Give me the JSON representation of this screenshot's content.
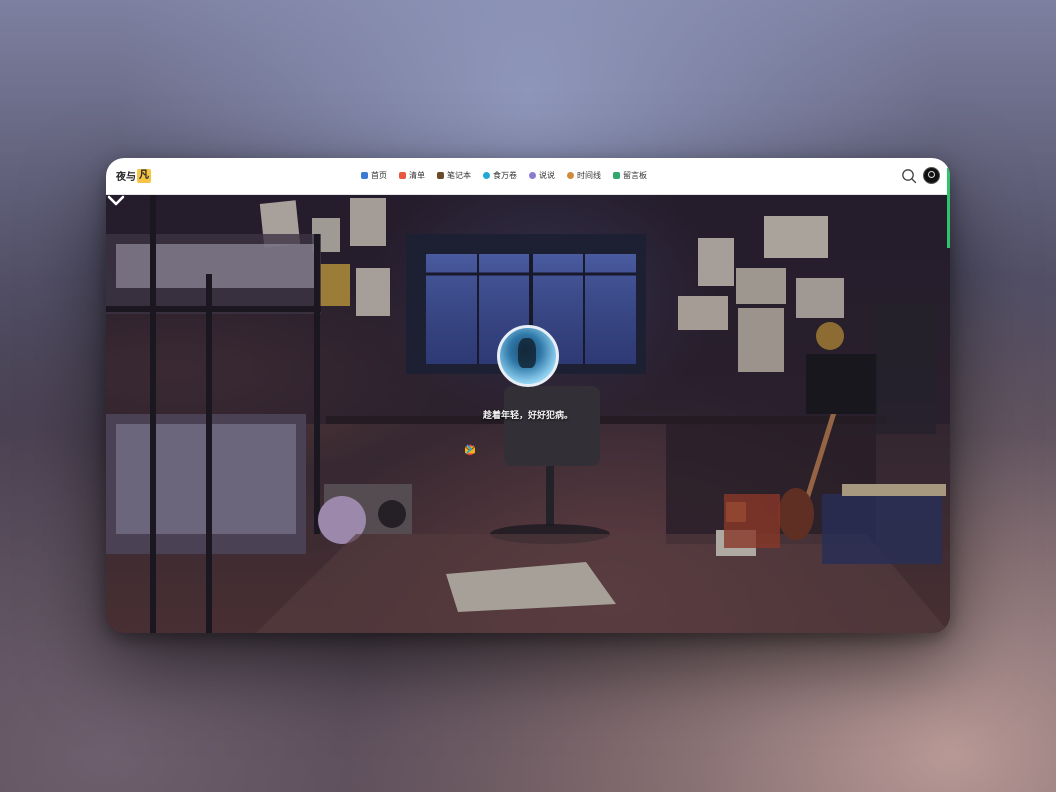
{
  "nav": {
    "logo_text": "夜与",
    "logo_badge": "凡",
    "menu": [
      {
        "label": "首页",
        "icon": "home-icon",
        "color": "#3a7bd5"
      },
      {
        "label": "清单",
        "icon": "list-icon",
        "color": "#e8573e"
      },
      {
        "label": "笔记本",
        "icon": "notebook-icon",
        "color": "#6b4a2a"
      },
      {
        "label": "食万卷",
        "icon": "food-icon",
        "color": "#22a7d6"
      },
      {
        "label": "说说",
        "icon": "chat-icon",
        "color": "#8a7bd1"
      },
      {
        "label": "时间线",
        "icon": "timeline-icon",
        "color": "#d08a3a"
      },
      {
        "label": "留言板",
        "icon": "message-icon",
        "color": "#2ea86b"
      }
    ]
  },
  "hero": {
    "motto": "趁着年轻，好好犯病。",
    "social_icons": [
      {
        "name": "prev-icon",
        "glyph": "‹",
        "color": "#1fa3e8"
      },
      {
        "name": "telegram-icon",
        "glyph": "➤",
        "color": "#1fa3e8"
      },
      {
        "name": "qq-icon",
        "glyph": "●",
        "color": "#1fa3e8"
      },
      {
        "name": "netease-music-icon",
        "glyph": "◉",
        "color": "#e23b3b"
      },
      {
        "name": "email-icon",
        "glyph": "✉",
        "color": "#f2b21c"
      },
      {
        "name": "next-icon",
        "glyph": "›",
        "color": "#1fa3e8"
      }
    ]
  },
  "colors": {
    "accent_green": "#30c46a",
    "logo_badge_bg": "#f6c545"
  }
}
